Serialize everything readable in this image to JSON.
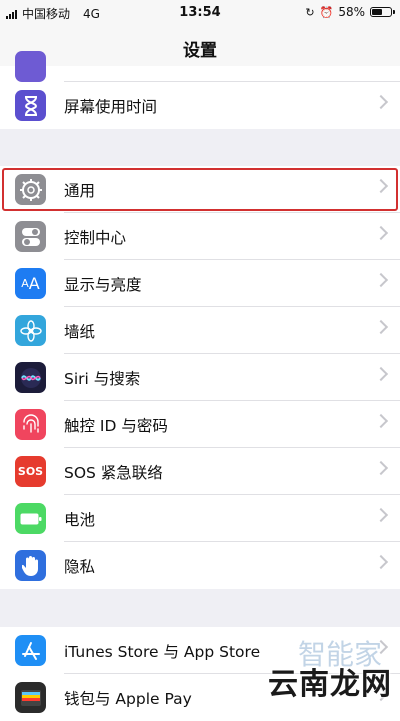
{
  "status_bar": {
    "carrier": "中国移动",
    "network": "4G",
    "time": "13:54",
    "battery_percent_label": "58%",
    "battery_level": 0.58
  },
  "nav": {
    "title": "设置"
  },
  "groups": [
    {
      "items": [
        {
          "label": "屏幕使用时间",
          "icon": "hourglass-icon",
          "color": "#5b4fcf"
        }
      ]
    },
    {
      "items": [
        {
          "label": "通用",
          "icon": "gear-icon",
          "color": "#8e8e93",
          "highlighted": true
        },
        {
          "label": "控制中心",
          "icon": "toggle-icon",
          "color": "#8e8e93"
        },
        {
          "label": "显示与亮度",
          "icon": "text-size-icon",
          "color": "#1e7cf2"
        },
        {
          "label": "墙纸",
          "icon": "flower-icon",
          "color": "#33a6dc"
        },
        {
          "label": "Siri 与搜索",
          "icon": "siri-icon",
          "color": "#1c1c3a"
        },
        {
          "label": "触控 ID 与密码",
          "icon": "fingerprint-icon",
          "color": "#f0455e"
        },
        {
          "label": "SOS 紧急联络",
          "icon": "sos-icon",
          "color": "#e63b2e",
          "icon_text": "SOS"
        },
        {
          "label": "电池",
          "icon": "battery-icon",
          "color": "#4cd964"
        },
        {
          "label": "隐私",
          "icon": "hand-icon",
          "color": "#2f6fde"
        }
      ]
    },
    {
      "items": [
        {
          "label": "iTunes Store 与 App Store",
          "icon": "app-store-icon",
          "color": "#1f8ff5"
        },
        {
          "label": "钱包与 Apple Pay",
          "icon": "wallet-icon",
          "color": "#2b2b2b"
        }
      ]
    }
  ],
  "watermark": {
    "text": "云南龙网",
    "text2": "智能家"
  }
}
